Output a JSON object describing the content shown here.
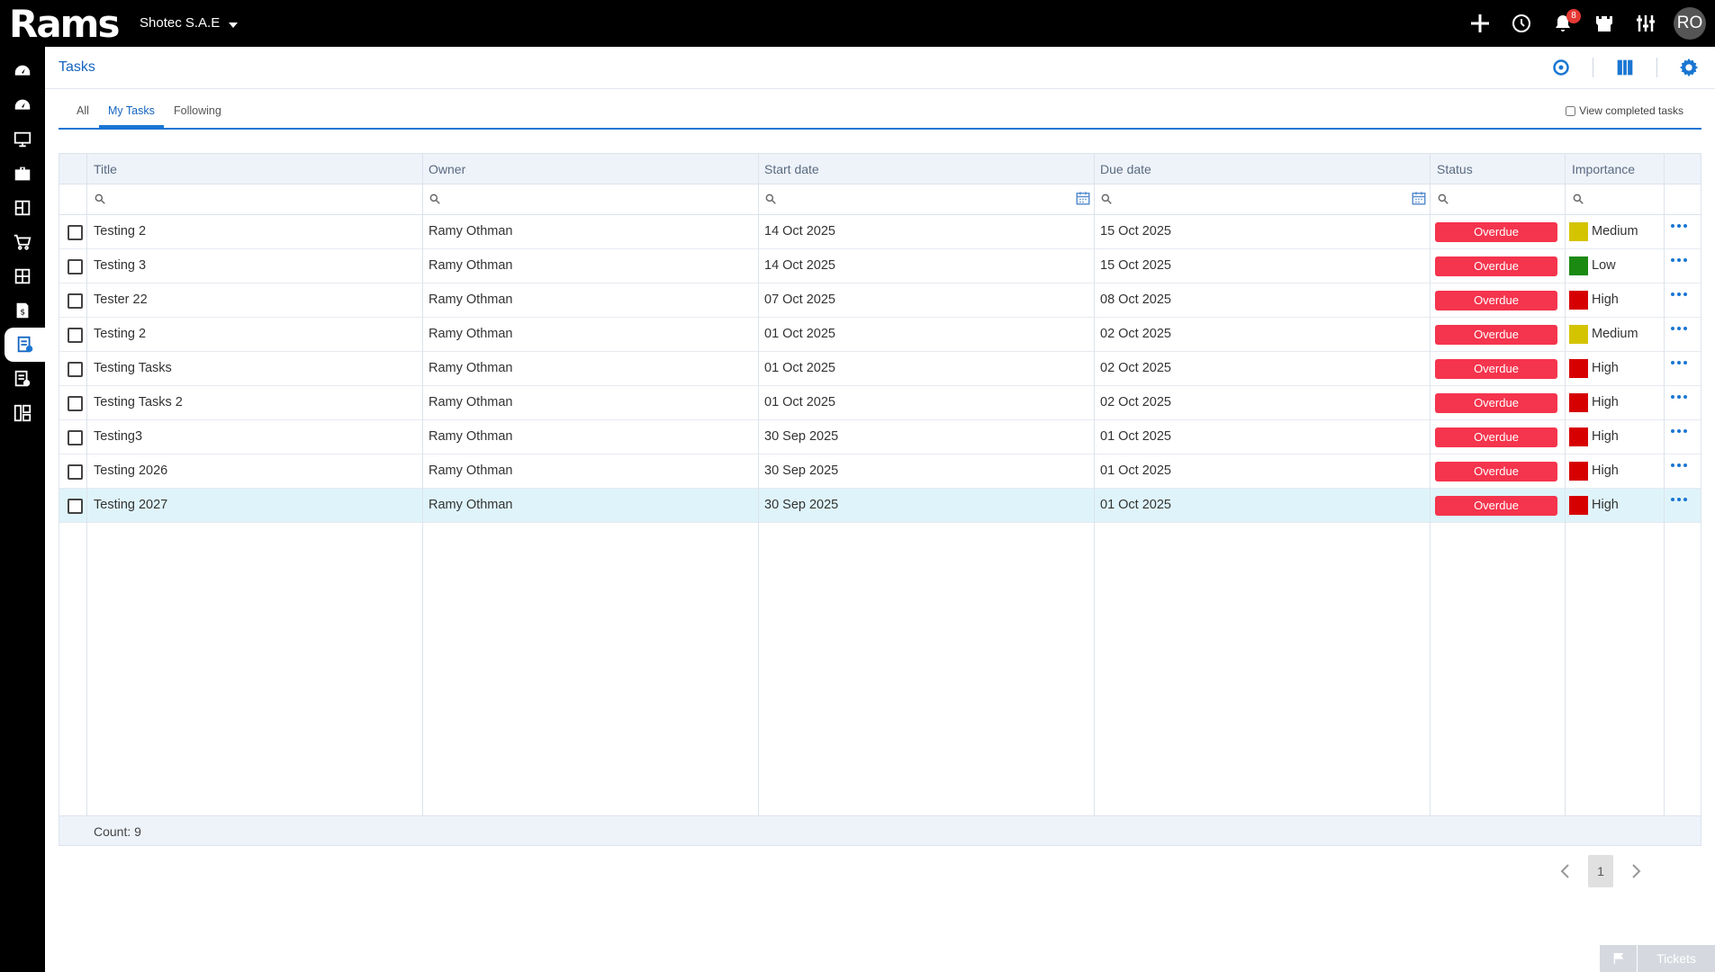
{
  "app": {
    "logo": "Rams",
    "company": "Shotec S.A.E"
  },
  "topbar": {
    "notification_count": "8",
    "avatar_initials": "RO"
  },
  "header": {
    "title": "Tasks"
  },
  "tabs": [
    {
      "label": "All",
      "active": false
    },
    {
      "label": "My Tasks",
      "active": true
    },
    {
      "label": "Following",
      "active": false
    }
  ],
  "view_completed_label": "View completed tasks",
  "columns": {
    "title": "Title",
    "owner": "Owner",
    "start_date": "Start date",
    "due_date": "Due date",
    "status": "Status",
    "importance": "Importance"
  },
  "rows": [
    {
      "title": "Testing 2",
      "owner": "Ramy Othman",
      "start": "14 Oct 2025",
      "due": "15 Oct 2025",
      "status": "Overdue",
      "importance": "Medium",
      "color": "#d4c400"
    },
    {
      "title": "Testing 3",
      "owner": "Ramy Othman",
      "start": "14 Oct 2025",
      "due": "15 Oct 2025",
      "status": "Overdue",
      "importance": "Low",
      "color": "#1b8a12"
    },
    {
      "title": "Tester 22",
      "owner": "Ramy Othman",
      "start": "07 Oct 2025",
      "due": "08 Oct 2025",
      "status": "Overdue",
      "importance": "High",
      "color": "#d60000"
    },
    {
      "title": "Testing 2",
      "owner": "Ramy Othman",
      "start": "01 Oct 2025",
      "due": "02 Oct 2025",
      "status": "Overdue",
      "importance": "Medium",
      "color": "#d4c400"
    },
    {
      "title": "Testing Tasks",
      "owner": "Ramy Othman",
      "start": "01 Oct 2025",
      "due": "02 Oct 2025",
      "status": "Overdue",
      "importance": "High",
      "color": "#d60000"
    },
    {
      "title": "Testing Tasks 2",
      "owner": "Ramy Othman",
      "start": "01 Oct 2025",
      "due": "02 Oct 2025",
      "status": "Overdue",
      "importance": "High",
      "color": "#d60000"
    },
    {
      "title": "Testing3",
      "owner": "Ramy Othman",
      "start": "30 Sep 2025",
      "due": "01 Oct 2025",
      "status": "Overdue",
      "importance": "High",
      "color": "#d60000"
    },
    {
      "title": "Testing 2026",
      "owner": "Ramy Othman",
      "start": "30 Sep 2025",
      "due": "01 Oct 2025",
      "status": "Overdue",
      "importance": "High",
      "color": "#d60000"
    },
    {
      "title": "Testing 2027",
      "owner": "Ramy Othman",
      "start": "30 Sep 2025",
      "due": "01 Oct 2025",
      "status": "Overdue",
      "importance": "High",
      "color": "#d60000",
      "selected": true
    }
  ],
  "footer": {
    "count": "Count: 9"
  },
  "pager": {
    "page": "1"
  },
  "tickets": {
    "label": "Tickets"
  },
  "colors": {
    "accent": "#1976d2",
    "overdue": "#f5344d",
    "header_bg": "#eef3fa",
    "selected_row": "#dff4fa"
  }
}
